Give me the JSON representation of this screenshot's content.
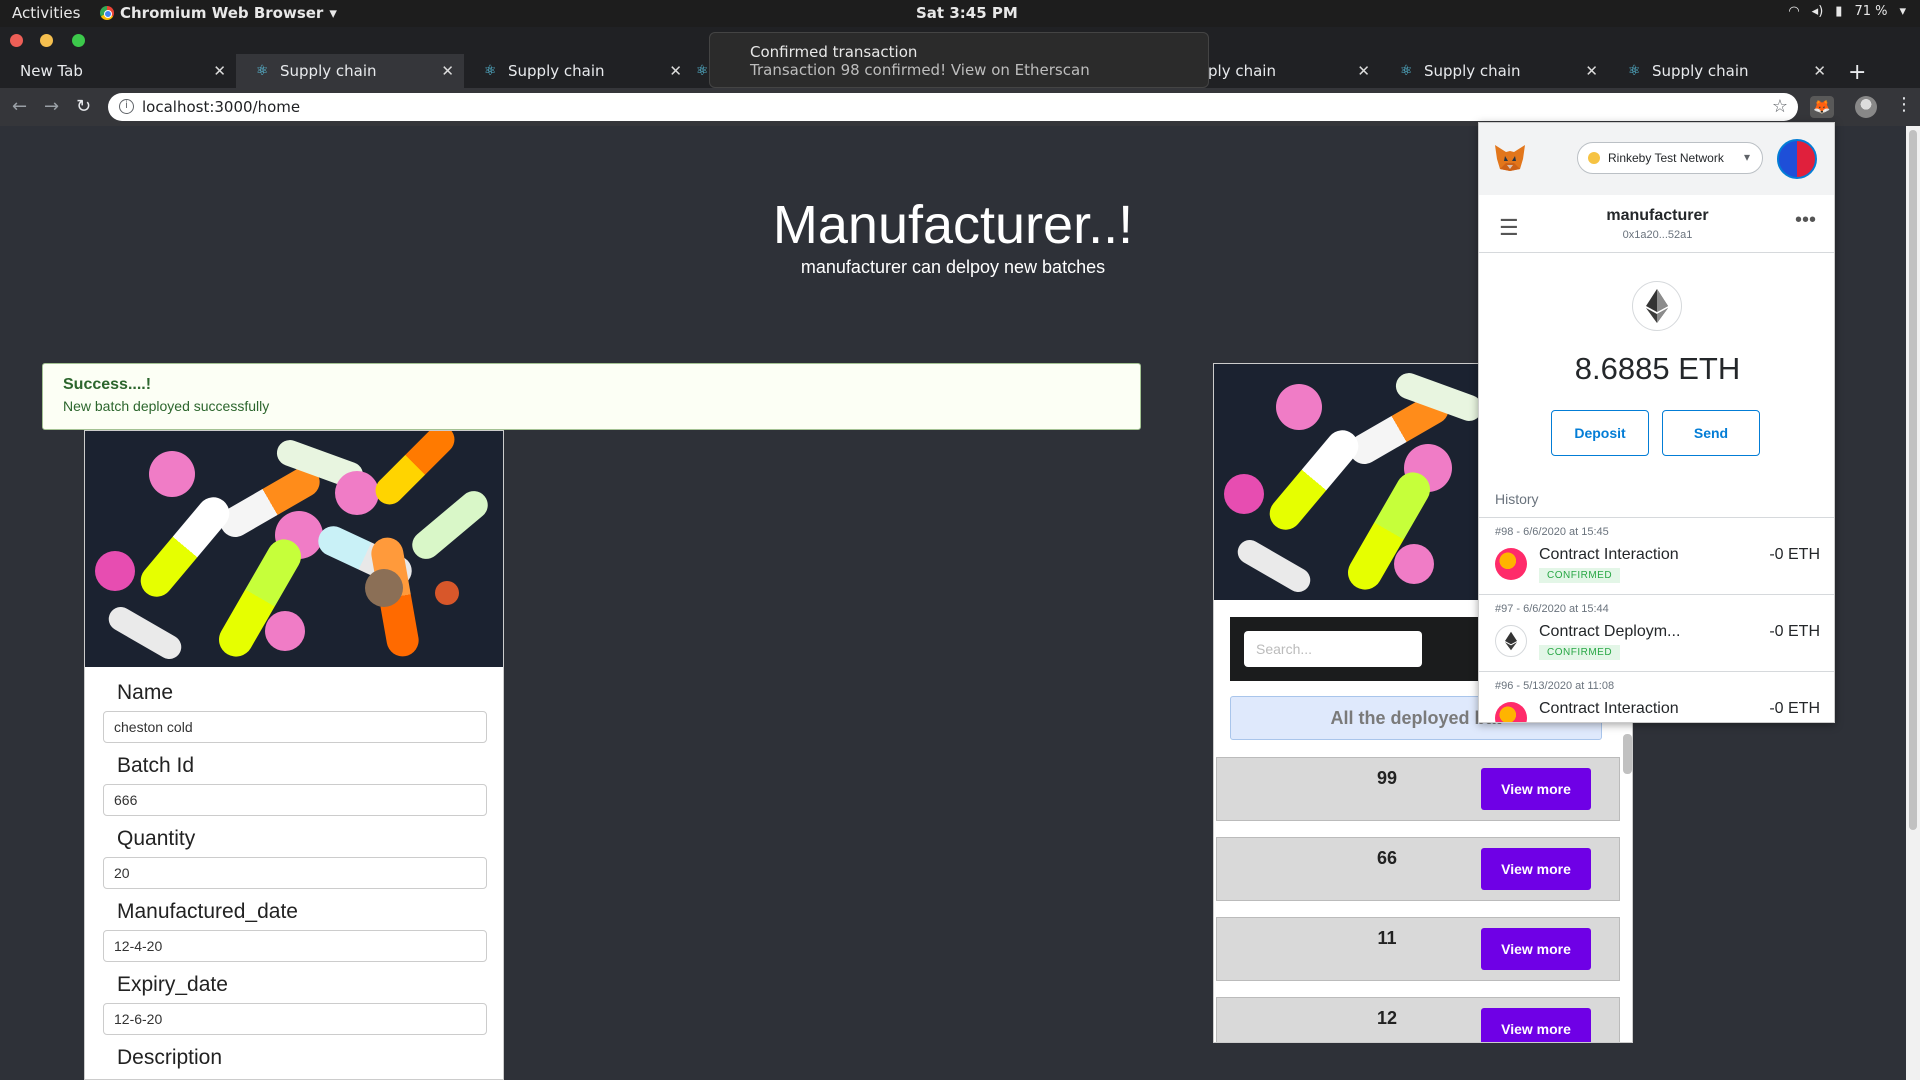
{
  "desktop": {
    "activities": "Activities",
    "app_name": "Chromium Web Browser",
    "clock": "Sat  3:45 PM",
    "battery": "71 %"
  },
  "browser": {
    "tabs": [
      {
        "label": "New Tab"
      },
      {
        "label": "Supply chain"
      },
      {
        "label": "Supply chain"
      },
      {
        "label": ""
      },
      {
        "label": "ply chain"
      },
      {
        "label": "Supply chain"
      },
      {
        "label": "Supply chain"
      }
    ],
    "url": "localhost:3000/home"
  },
  "toast": {
    "title": "Confirmed transaction",
    "message": "Transaction 98 confirmed! View on Etherscan"
  },
  "page": {
    "title": "Manufacturer..!",
    "subtitle": "manufacturer can delpoy new batches",
    "alert": {
      "header": "Success....!",
      "message": "New batch deployed successfully"
    },
    "form": {
      "fields": [
        {
          "label": "Name",
          "value": "cheston  cold"
        },
        {
          "label": "Batch Id",
          "value": "666"
        },
        {
          "label": "Quantity",
          "value": "20"
        },
        {
          "label": "Manufactured_date",
          "value": "12-4-20"
        },
        {
          "label": "Expiry_date",
          "value": "12-6-20"
        },
        {
          "label": "Description",
          "value": ""
        }
      ]
    },
    "list": {
      "search_placeholder": "Search...",
      "banner": "All the deployed bat",
      "view_more_label": "View more",
      "batches": [
        "99",
        "66",
        "11",
        "12"
      ]
    }
  },
  "metamask": {
    "network": "Rinkeby Test Network",
    "account_name": "manufacturer",
    "account_address": "0x1a20...52a1",
    "balance": "8.6885 ETH",
    "deposit_label": "Deposit",
    "send_label": "Send",
    "history_label": "History",
    "transactions": [
      {
        "meta": "#98 - 6/6/2020 at 15:45",
        "title": "Contract Interaction",
        "status": "CONFIRMED",
        "amount": "-0 ETH",
        "icon": "contract-icon"
      },
      {
        "meta": "#97 - 6/6/2020 at 15:44",
        "title": "Contract Deploym...",
        "status": "CONFIRMED",
        "amount": "-0 ETH",
        "icon": "ethereum-icon"
      },
      {
        "meta": "#96 - 5/13/2020 at 11:08",
        "title": "Contract Interaction",
        "status": "",
        "amount": "-0 ETH",
        "icon": "contract-icon"
      }
    ]
  }
}
